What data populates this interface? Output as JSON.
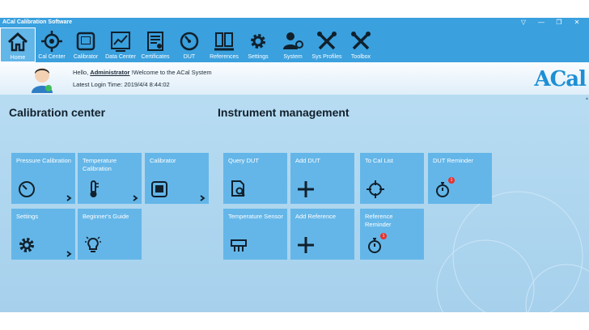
{
  "window": {
    "title": "ACal Calibration Software",
    "controls": [
      "▽",
      "—",
      "❐",
      "✕"
    ]
  },
  "toolbar": {
    "items": [
      {
        "label": "Home",
        "icon": "home-icon",
        "active": true
      },
      {
        "label": "Cal Center",
        "icon": "crosshair-icon"
      },
      {
        "label": "Calibrator",
        "icon": "calibrator-icon"
      },
      {
        "label": "Data Center",
        "icon": "chart-icon"
      },
      {
        "label": "Certificates",
        "icon": "certificate-icon"
      },
      {
        "label": "DUT",
        "icon": "gauge-icon"
      },
      {
        "label": "References",
        "icon": "references-icon"
      },
      {
        "label": "Settings",
        "icon": "gear-icon"
      },
      {
        "label": "System",
        "icon": "user-settings-icon"
      },
      {
        "label": "Sys Profiles",
        "icon": "tools-icon"
      },
      {
        "label": "Toolbox",
        "icon": "tools-icon"
      }
    ]
  },
  "welcome": {
    "hello_prefix": "Hello,",
    "user": "Administrator",
    "hello_suffix": "!Welcome to the ACal System",
    "login_label": "Latest Login Time:",
    "login_time": "2019/4/4 8:44:02",
    "brand": "ACal"
  },
  "calibration": {
    "title": "Calibration center",
    "tiles": [
      {
        "label": "Pressure Calibration",
        "icon": "gauge-icon"
      },
      {
        "label": "Temperature Calibration",
        "icon": "thermometer-icon"
      },
      {
        "label": "Calibrator",
        "icon": "calibrator-icon"
      },
      {
        "label": "Settings",
        "icon": "gear-icon"
      },
      {
        "label": "Beginner's Guide",
        "icon": "lightbulb-icon"
      }
    ]
  },
  "instrument": {
    "title": "Instrument management",
    "tiles": [
      {
        "label": "Query DUT",
        "icon": "query-document-icon"
      },
      {
        "label": "Add DUT",
        "icon": "plus-icon"
      },
      {
        "label": "To Cal List",
        "icon": "crosshair-icon"
      },
      {
        "label": "DUT Reminder",
        "icon": "stopwatch-icon",
        "badge": "1"
      },
      {
        "label": "Temperature Sensor",
        "icon": "sensor-icon"
      },
      {
        "label": "Add Reference",
        "icon": "plus-icon"
      },
      {
        "label": "Reference Reminder",
        "icon": "stopwatch-icon",
        "badge": "1"
      }
    ]
  }
}
